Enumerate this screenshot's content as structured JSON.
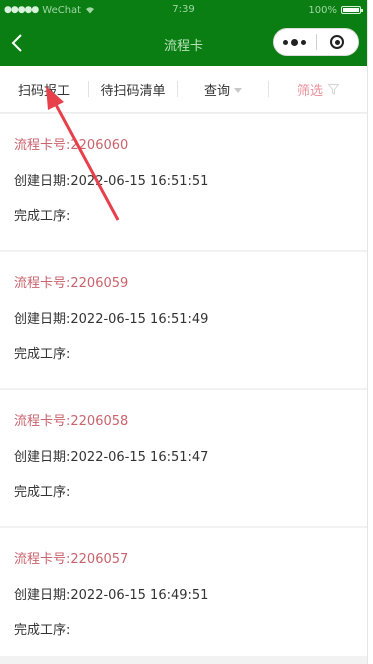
{
  "status_bar": {
    "carrier": "WeChat",
    "time": "7:39",
    "battery": "100%"
  },
  "nav": {
    "title": "流程卡",
    "back_icon": "chevron-left-icon",
    "more_icon": "more-dots-icon",
    "close_icon": "circle-dot-icon"
  },
  "filter_bar": {
    "scan_report": "扫码报工",
    "pending_scan_list": "待扫码清单",
    "query": "查询",
    "filter": "筛选",
    "filter_color": "#e9919a"
  },
  "cards": [
    {
      "id_label": "流程卡号:2206060",
      "date_label": "创建日期:2022-06-15 16:51:51",
      "steps_label": "完成工序:"
    },
    {
      "id_label": "流程卡号:2206059",
      "date_label": "创建日期:2022-06-15 16:51:49",
      "steps_label": "完成工序:"
    },
    {
      "id_label": "流程卡号:2206058",
      "date_label": "创建日期:2022-06-15 16:51:47",
      "steps_label": "完成工序:"
    },
    {
      "id_label": "流程卡号:2206057",
      "date_label": "创建日期:2022-06-15 16:49:51",
      "steps_label": "完成工序:"
    }
  ],
  "colors": {
    "nav_green": "#0a7d13",
    "card_id_red": "#c9636c",
    "annotation_arrow": "#e8404a"
  }
}
